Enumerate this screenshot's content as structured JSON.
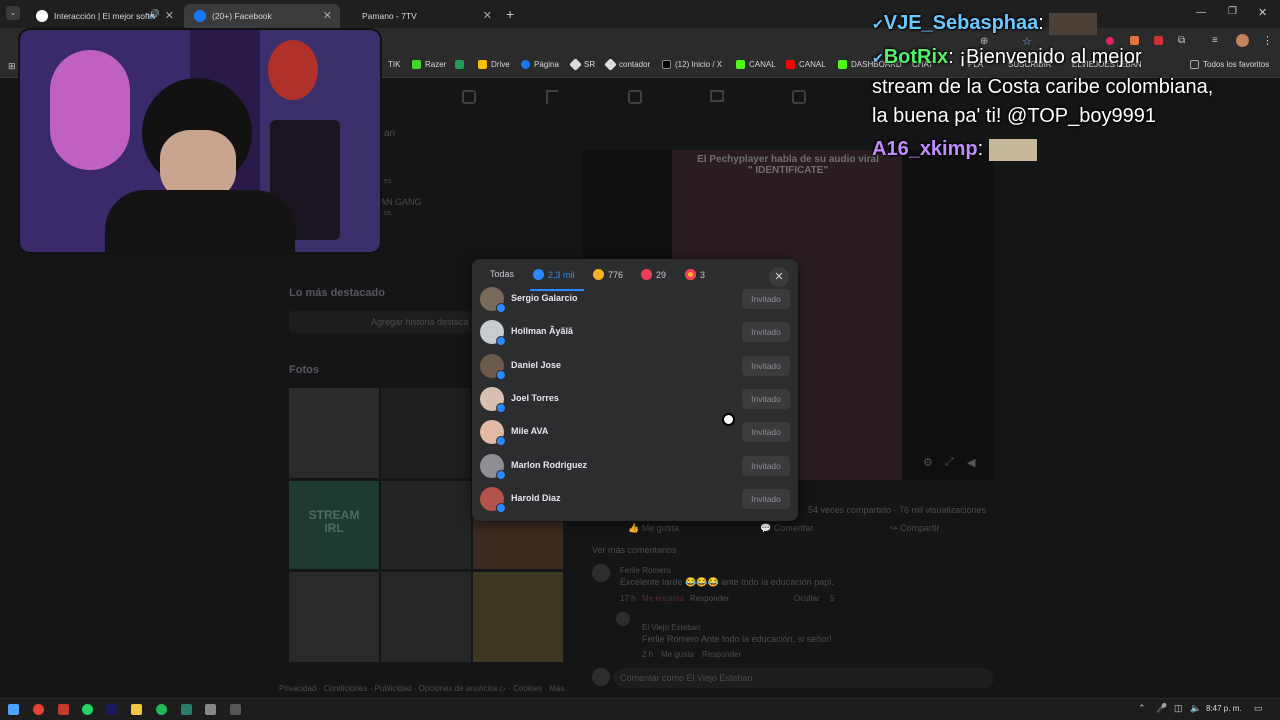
{
  "tabs": [
    {
      "label": "Interacción | El mejor softw"
    },
    {
      "label": "(20+) Facebook"
    },
    {
      "label": "Pamano - 7TV"
    }
  ],
  "bookmarks": [
    "TIK",
    "Razer",
    "Drive",
    "Página",
    "SR",
    "contador",
    "(12) Inicio / X",
    "CANAL",
    "CANAL",
    "DASHBOARD",
    "CHAT",
    "PLA",
    "SUSCRIBIR",
    "ELVIEJOESTEBAN",
    "Todos los favoritos"
  ],
  "colors": {
    "accent": "#2d88ff",
    "brand": "#1877f2",
    "modal_bg": "#2c2d2f"
  },
  "page": {
    "highlights_title": "Lo más destacado",
    "add_story": "Agregar historia destaca",
    "photos_title": "Fotos",
    "video_title_line1": "El Pechyplayer habla de su audio viral",
    "video_title_line2": "\" IDENTIFICATE\"",
    "stats": "54 veces compartido · 76 mil visualizaciones",
    "like": "Me gusta",
    "comment": "Comentar",
    "share": "Compartir",
    "see_more": "Ver más comentarios",
    "c1_author": "Ferlie Romero",
    "c1_text": "Excelente tarde 😂😂😂 ante todo la educación papi.",
    "c1_time": "17 h",
    "c1_like": "Me encanta",
    "c1_reply": "Responder",
    "c1_hide": "Ocultar",
    "c1_count": "5",
    "c2_author": "El Viejo Esteban",
    "c2_text": "Ferlie Romero Ante todo la educación, si señor!",
    "c2_time": "2 h",
    "c2_like": "Me gusta",
    "c2_reply": "Responder",
    "comment_as": "Comentar como El Viejo Esteban",
    "footer": "Privacidad · Condiciones · Publicidad · Opciones de anuncios ▷ · Cookies · Más",
    "side_name_fragment": "AN GANG",
    "side_small1": "es",
    "side_small2": "os",
    "side_top": "an"
  },
  "modal": {
    "tab_all": "Todas",
    "tab_like": "2,3 mil",
    "tab_haha": "776",
    "tab_love": "29",
    "tab_care": "3",
    "close_label": "✕",
    "rows": [
      {
        "name": "Sergio Galarcio",
        "button": "Invitado"
      },
      {
        "name": "Hollman Ãyãlã",
        "button": "Invitado"
      },
      {
        "name": "Daniel Jose",
        "button": "Invitado"
      },
      {
        "name": "Joel Torres",
        "button": "Invitado"
      },
      {
        "name": "Mile AVA",
        "button": "Invitado"
      },
      {
        "name": "Marlon Rodriguez",
        "button": "Invitado"
      },
      {
        "name": "Harold Diaz",
        "button": "Invitado"
      }
    ]
  },
  "chat": {
    "l1_user": "VJE_Sebasphaa",
    "l2_user": "BotRix",
    "l2_text": ": ¡Bienvenido al mejor",
    "l3_text": "stream de la Costa caribe colombiana,",
    "l4_text": "la buena pa' ti! @TOP_boy9991",
    "l5_user": "A16_xkimp",
    "colon": ":"
  },
  "taskbar": {
    "time": "8:47 p. m."
  }
}
